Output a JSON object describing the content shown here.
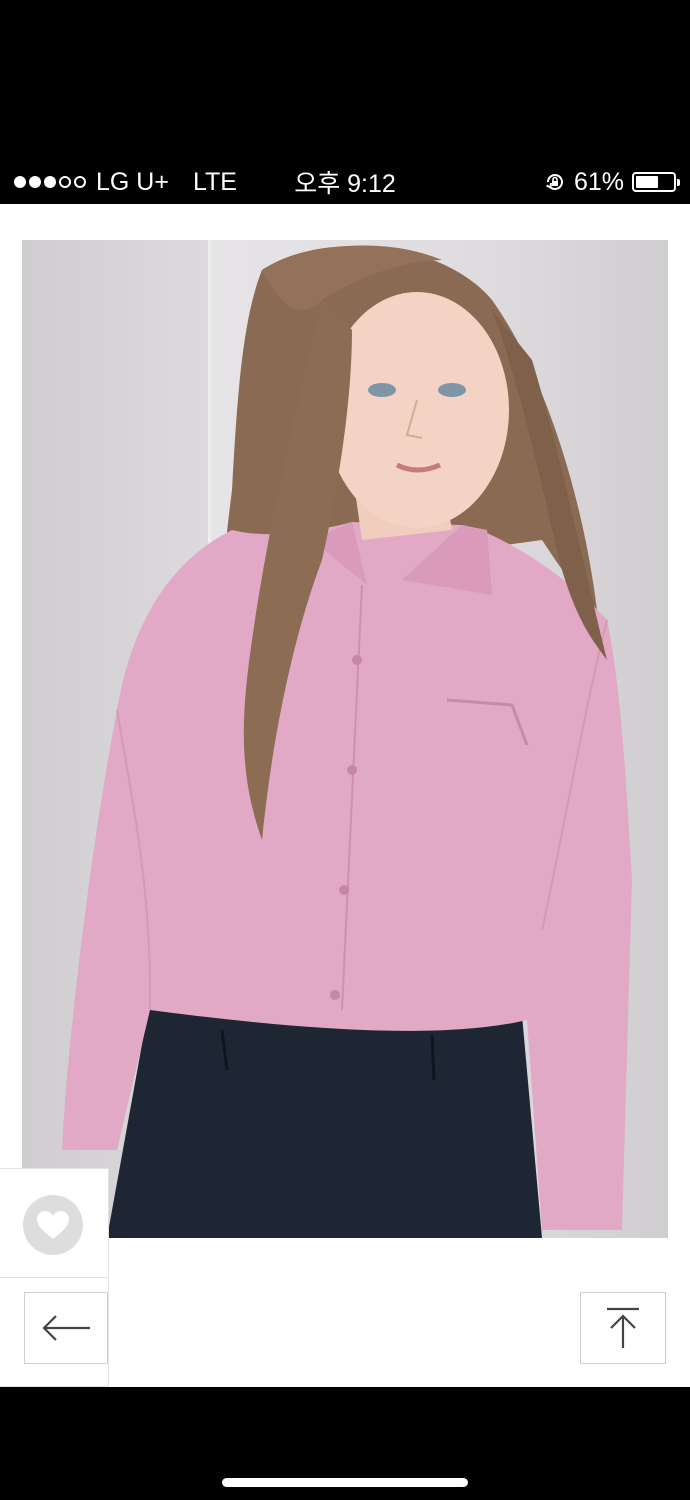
{
  "status_bar": {
    "signal_filled": 3,
    "signal_total": 5,
    "carrier": "LG U+",
    "network": "LTE",
    "time": "오후 9:12",
    "battery_percent": "61%",
    "battery_level": 0.61
  },
  "product": {
    "image": "model-wearing-pink-shirt-and-navy-trousers",
    "shirt_color": "#e2a9c6",
    "trouser_color": "#1f2633"
  },
  "controls": {
    "favorite_icon": "heart-icon",
    "back_icon": "arrow-left-icon",
    "top_icon": "arrow-up-to-top-icon"
  },
  "colors": {
    "status_bar_bg": "#000000",
    "page_bg": "#ffffff",
    "button_border": "#cfcfcf"
  }
}
